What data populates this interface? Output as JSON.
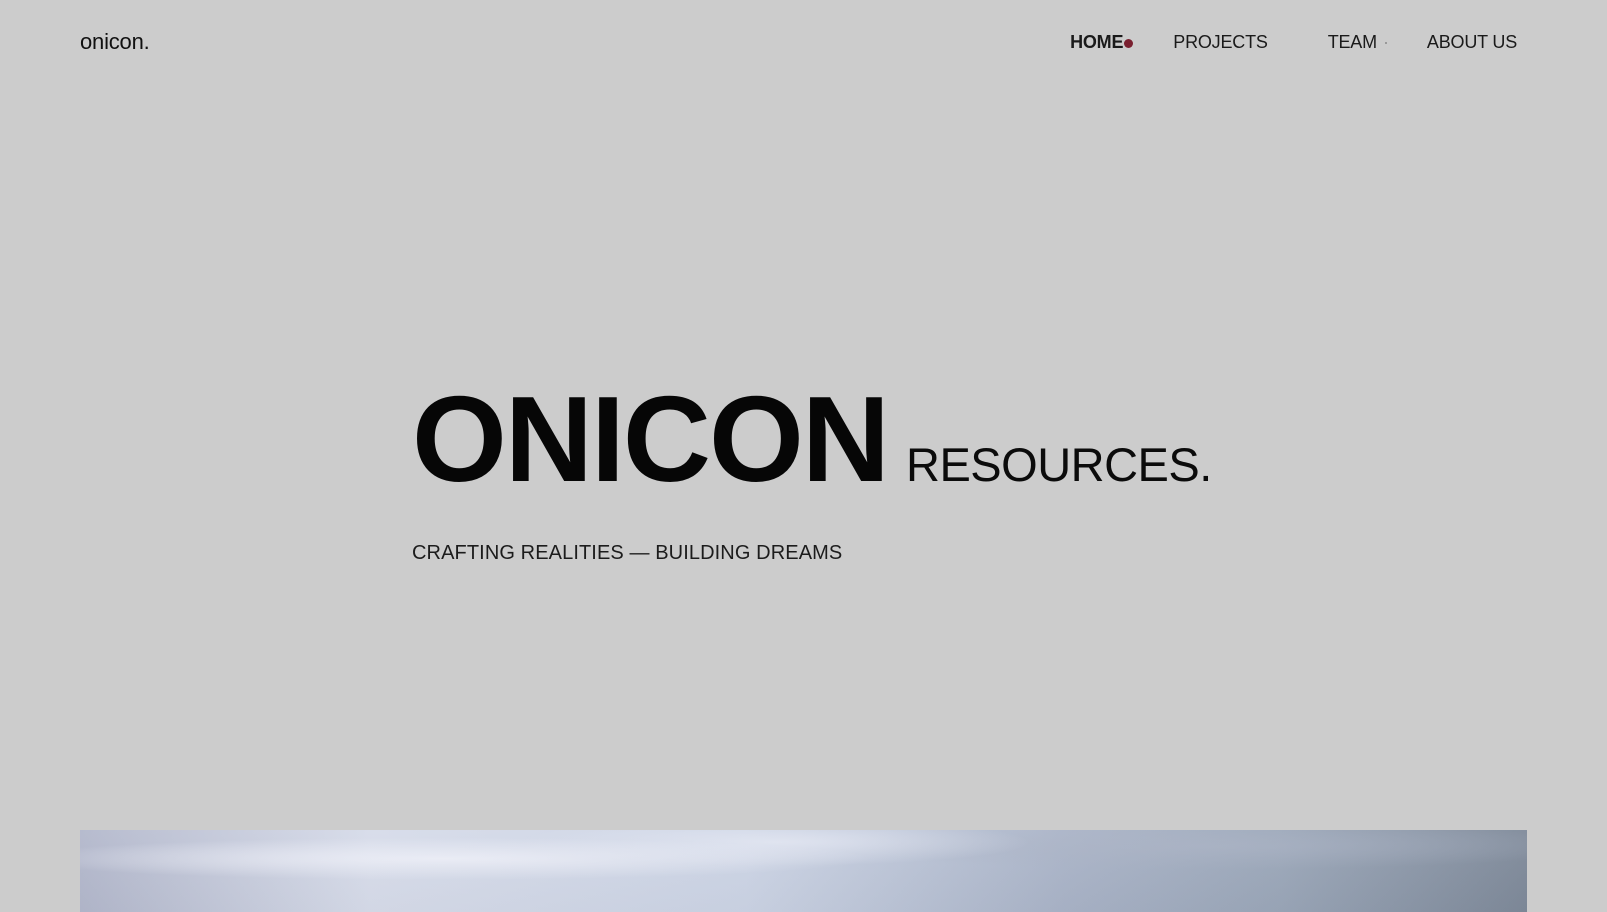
{
  "header": {
    "logo": "onicon."
  },
  "nav": {
    "items": [
      {
        "label": "HOME",
        "active": true
      },
      {
        "label": "PROJECTS",
        "active": false
      },
      {
        "label": "TEAM",
        "active": false
      },
      {
        "label": "ABOUT US",
        "active": false
      }
    ],
    "active_indicator_color": "#7a2030"
  },
  "hero": {
    "brand_main": "ONICON",
    "brand_sub": "RESOURCES.",
    "tagline": "CRAFTING REALITIES — BUILDING DREAMS"
  },
  "colors": {
    "background": "#cccccc",
    "text": "#0a0a0a"
  }
}
